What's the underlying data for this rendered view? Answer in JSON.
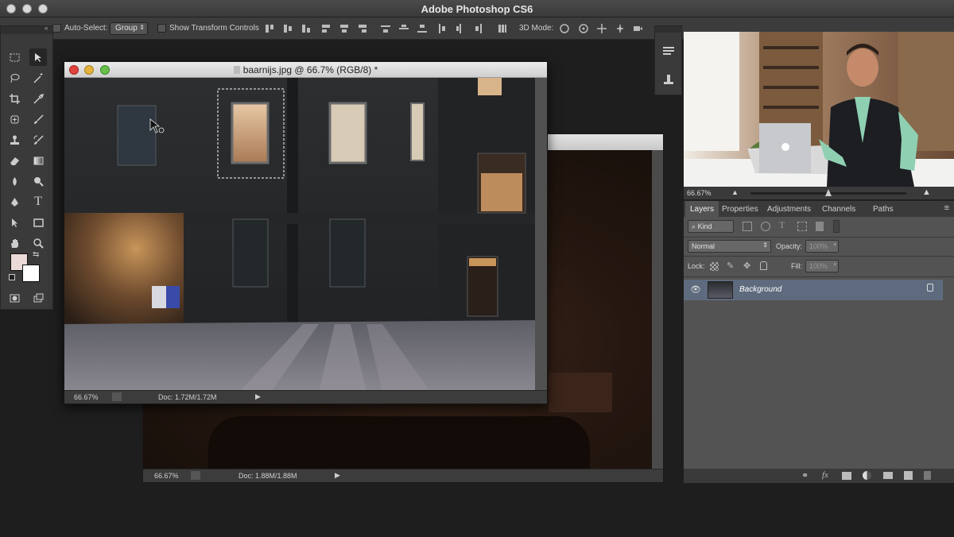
{
  "app": {
    "title": "Adobe Photoshop CS6"
  },
  "options_bar": {
    "auto_select_label": "Auto-Select:",
    "auto_select_value": "Group",
    "show_transform_label": "Show Transform Controls",
    "mode_3d_label": "3D Mode:"
  },
  "front_document": {
    "title": "baarnijs.jpg @ 66.7% (RGB/8) *",
    "zoom": "66.67%",
    "doc_size": "Doc: 1.72M/1.72M"
  },
  "back_document": {
    "zoom": "66.67%",
    "doc_size": "Doc: 1.88M/1.88M"
  },
  "video_panel": {
    "zoom": "66.67%"
  },
  "layers_panel": {
    "tabs": [
      "Layers",
      "Properties",
      "Adjustments",
      "Channels",
      "Paths"
    ],
    "filter_kind": "Kind",
    "blend_mode": "Normal",
    "opacity_label": "Opacity:",
    "opacity_value": "100%",
    "lock_label": "Lock:",
    "fill_label": "Fill:",
    "fill_value": "100%",
    "layers": [
      {
        "name": "Background",
        "visible": true,
        "locked": true
      }
    ]
  },
  "colors": {
    "selected_layer": "#5e6b7e",
    "panel": "#535353",
    "chrome": "#3a3a3a"
  }
}
